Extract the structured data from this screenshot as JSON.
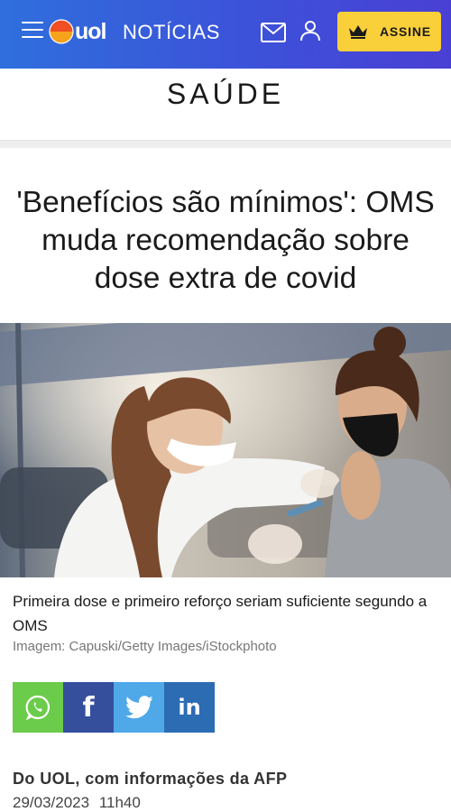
{
  "header": {
    "logo_text": "uol",
    "section_name": "NOTÍCIAS",
    "subscribe_label": "ASSINE",
    "colors": {
      "bar_start": "#2f6fdc",
      "bar_end": "#4a3fd4",
      "subscribe_bg": "#f9cf3a"
    },
    "icons": [
      "menu-icon",
      "mail-icon",
      "user-icon",
      "crown-icon"
    ]
  },
  "section": {
    "title": "SAÚDE"
  },
  "article": {
    "headline": "'Benefícios são mínimos': OMS muda recomendação sobre dose extra de covid",
    "image_caption": "Primeira dose e primeiro reforço seriam suficiente segundo a OMS",
    "image_credit": "Imagem: Capuski/Getty Images/iStockphoto",
    "byline": "Do UOL, com informações da AFP",
    "date": "29/03/2023",
    "time": "11h40"
  },
  "share": {
    "buttons": [
      {
        "network": "whatsapp",
        "icon": "whatsapp-icon",
        "color": "#6bcb4a"
      },
      {
        "network": "facebook",
        "label": "f",
        "icon": "facebook-icon",
        "color": "#354f9d"
      },
      {
        "network": "twitter",
        "icon": "twitter-icon",
        "color": "#4fa8e8"
      },
      {
        "network": "linkedin",
        "label": "in",
        "icon": "linkedin-icon",
        "color": "#2c6cb3"
      }
    ]
  }
}
